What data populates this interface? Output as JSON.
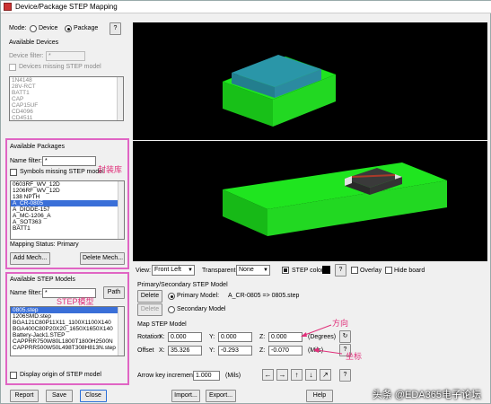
{
  "window": {
    "title": "Device/Package STEP Mapping"
  },
  "mode": {
    "label": "Mode:",
    "device": "Device",
    "package": "Package",
    "help": "?"
  },
  "devices": {
    "group_label": "Available Devices",
    "filter_label": "Device filter:",
    "filter_value": "*",
    "missing_label": "Devices missing STEP model",
    "items": [
      "1N4148",
      "28V-RCT",
      "BATT1",
      "CAP",
      "CAP15UF",
      "CD4096",
      "CD4511"
    ]
  },
  "packages": {
    "group_label": "Available Packages",
    "filter_label": "Name filter:",
    "filter_value": "*",
    "missing_label": "Symbols missing STEP model",
    "items": [
      "0603RF_WV_12D",
      "1206RF_WV_12D",
      "138 NPTH",
      "A_CR-0805",
      "A_DIODE-157",
      "A_MC-1206_A",
      "A_SOT363",
      "BATT1"
    ],
    "selected_index": 3,
    "mapping_status": "Mapping Status: Primary",
    "add_button": "Add Mech...",
    "delete_button": "Delete Mech..."
  },
  "step_models": {
    "group_label": "Available STEP Models",
    "filter_label": "Name filter:",
    "filter_value": "*",
    "path_button": "Path",
    "items": [
      "0805.step",
      "1206SMD.step",
      "BGA121C80P11X11_1100X1100X140",
      "BGA400C80P20X20_1650X1650X140",
      "Battery-Jack1.STEP",
      "CAPPRR750W80L1800T1800H2500N",
      "CAPPRR500W50L498T308H813N.step"
    ],
    "selected_index": 0,
    "display_origin": "Display origin of STEP model"
  },
  "annotations": {
    "packages": "封装库",
    "step": "STEP模型",
    "rotation": "方向",
    "offset": "坐标"
  },
  "view": {
    "label": "View:",
    "value": "Front Left",
    "transparent_label": "Transparent:",
    "transparent_value": "None",
    "step_color_label": "STEP color",
    "help": "?",
    "overlay_label": "Overlay",
    "hide_board_label": "Hide board"
  },
  "primary": {
    "group_label": "Primary/Secondary STEP Model",
    "delete_label": "Delete",
    "primary_label": "Primary Model:",
    "mapping_text": "A_CR-0805 => 0805.step",
    "secondary_label": "Secondary Model"
  },
  "map": {
    "group_label": "Map STEP Model",
    "rotation_label": "Rotation",
    "offset_label": "Offset",
    "x": "X:",
    "y": "Y:",
    "z": "Z:",
    "rot_x": "0.000",
    "rot_y": "0.000",
    "rot_z": "0.000",
    "off_x": "35.326",
    "off_y": "-0.293",
    "off_z": "-0.070",
    "rot_unit": "(Degrees)",
    "off_unit": "(Mils)",
    "rot_btn": "↻",
    "help": "?"
  },
  "arrow": {
    "label": "Arrow key increment:",
    "value": "1.000",
    "unit": "(Mils)",
    "help": "?"
  },
  "footer": {
    "report": "Report",
    "save": "Save",
    "close": "Close",
    "import": "Import...",
    "export": "Export...",
    "help": "Help"
  },
  "watermark": "头条 @EDA365电子论坛",
  "colors": {
    "pink": "#e065c4",
    "board": "#22e022",
    "selection": "#3a6fd8"
  }
}
